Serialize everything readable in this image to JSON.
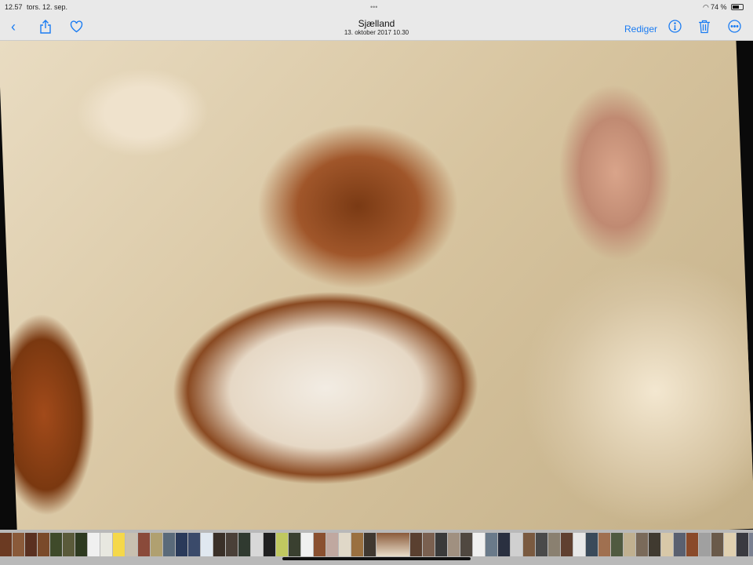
{
  "status_bar": {
    "time": "12.57",
    "date": "tors. 12. sep.",
    "multitask": "•••",
    "battery": "74 %"
  },
  "header": {
    "title": "Sjælland",
    "subtitle": "13. oktober 2017  10.30",
    "edit_label": "Rediger"
  },
  "icons": {
    "back": "chevron-left-icon",
    "share": "share-icon",
    "favorite": "heart-icon",
    "info": "info-icon",
    "trash": "trash-icon",
    "more": "more-icon"
  },
  "accent": "#1b7cf2",
  "thumbnail_colors": [
    "#6b3a22",
    "#8a5a3a",
    "#5a3020",
    "#7a4a2a",
    "#3f4a2a",
    "#5a5a3a",
    "#2e3a20",
    "#f0f0f0",
    "#e8e8e0",
    "#f5d84a",
    "#c8c0b0",
    "#8a4a3a",
    "#b0a070",
    "#5a6a7a",
    "#2a3a5a",
    "#3a4a6a",
    "#e0e8f0",
    "#3a3028",
    "#4a4038",
    "#303a30",
    "#d8d8d8",
    "#202020",
    "#c0c860",
    "#3a4030",
    "#f0f0f0",
    "#8a5030",
    "#c0a8a0",
    "#e0d8c8",
    "#9a7040",
    "#403830",
    "#b9b9b9",
    "#5a4030",
    "#7a6050",
    "#3a3a3a",
    "#a09080",
    "#504840",
    "#f0f0f0",
    "#6a7a8a",
    "#2a3040",
    "#d0d0d0",
    "#7a5a40",
    "#4a4a4a",
    "#8a8070",
    "#604030",
    "#e8e8e8",
    "#3a4a5a",
    "#a07050",
    "#505a40",
    "#c0b090",
    "#7a6a5a",
    "#403a30",
    "#d8c8a8",
    "#5a6070",
    "#8a4a2a",
    "#a0a0a0",
    "#6a5a4a",
    "#e0d0b0",
    "#3a3a40",
    "#7a8090",
    "#c09070"
  ]
}
